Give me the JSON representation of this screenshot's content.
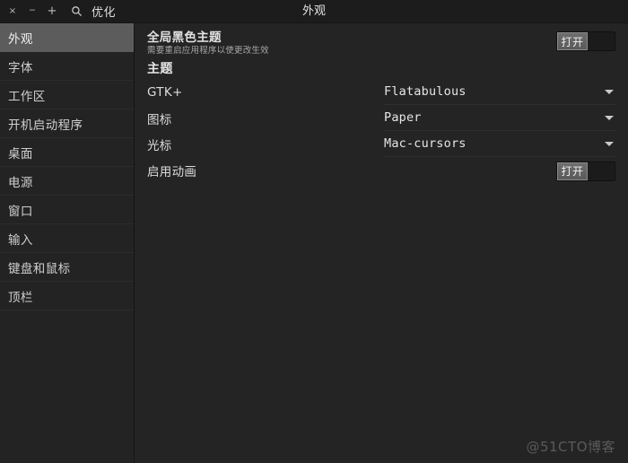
{
  "window": {
    "app_title": "优化",
    "header_title": "外观",
    "controls": {
      "close": "×",
      "minimize": "‒",
      "maximize": "+"
    },
    "search_icon": "search-icon"
  },
  "sidebar": {
    "items": [
      {
        "label": "外观",
        "selected": true
      },
      {
        "label": "字体",
        "selected": false
      },
      {
        "label": "工作区",
        "selected": false
      },
      {
        "label": "开机启动程序",
        "selected": false
      },
      {
        "label": "桌面",
        "selected": false
      },
      {
        "label": "电源",
        "selected": false
      },
      {
        "label": "窗口",
        "selected": false
      },
      {
        "label": "输入",
        "selected": false
      },
      {
        "label": "键盘和鼠标",
        "selected": false
      },
      {
        "label": "顶栏",
        "selected": false
      }
    ]
  },
  "main": {
    "global_dark_theme": {
      "title": "全局黑色主题",
      "subtitle": "需要重启应用程序以使更改生效",
      "switch_label": "打开",
      "switch_state": "on"
    },
    "section_theme": "主题",
    "combos": [
      {
        "label": "GTK+",
        "value": "Flatabulous"
      },
      {
        "label": "图标",
        "value": "Paper"
      },
      {
        "label": "光标",
        "value": "Mac-cursors"
      }
    ],
    "enable_animations": {
      "label": "启用动画",
      "switch_label": "打开",
      "switch_state": "on"
    }
  },
  "watermark": "@51CTO博客",
  "colors": {
    "window_bg": "#242424",
    "titlebar_bg": "#1c1c1c",
    "sidebar_bg": "#232323",
    "sidebar_selected": "#5c5c5c",
    "text_primary": "#e2e2e2",
    "text_secondary": "#a7a7a7",
    "switch_trough": "#1b1b1b",
    "switch_knob": "#5f5f5f"
  }
}
